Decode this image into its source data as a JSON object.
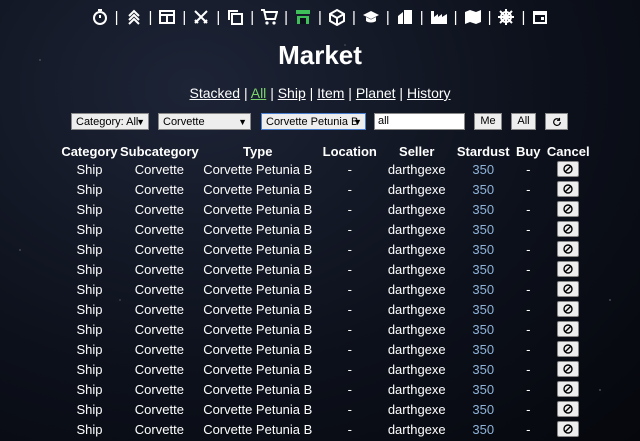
{
  "nav": {
    "icons": [
      "stopwatch-icon",
      "rank-chevrons-icon",
      "dashboard-icon",
      "crossed-swords-icon",
      "copy-icon",
      "cart-icon",
      "market-icon",
      "box-icon",
      "graduation-cap-icon",
      "city-icon",
      "factory-icon",
      "map-icon",
      "ship-wheel-icon",
      "calendar-icon"
    ],
    "active_icon": "market-icon",
    "active_color": "#3fbf5a"
  },
  "page_title": "Market",
  "filters": {
    "stacked": "Stacked",
    "all": "All",
    "ship": "Ship",
    "item": "Item",
    "planet": "Planet",
    "history": "History",
    "separator": "|"
  },
  "controls": {
    "category": "Category: All",
    "subcategory": "Corvette",
    "type": "Corvette Petunia B",
    "search_value": "all",
    "me_label": "Me",
    "all_label": "All"
  },
  "table": {
    "headers": [
      "Category",
      "Subcategory",
      "Type",
      "Location",
      "Seller",
      "Stardust",
      "Buy",
      "Cancel"
    ],
    "rows": [
      [
        "Ship",
        "Corvette",
        "Corvette Petunia B",
        "-",
        "darthgexe",
        "350",
        "-"
      ],
      [
        "Ship",
        "Corvette",
        "Corvette Petunia B",
        "-",
        "darthgexe",
        "350",
        "-"
      ],
      [
        "Ship",
        "Corvette",
        "Corvette Petunia B",
        "-",
        "darthgexe",
        "350",
        "-"
      ],
      [
        "Ship",
        "Corvette",
        "Corvette Petunia B",
        "-",
        "darthgexe",
        "350",
        "-"
      ],
      [
        "Ship",
        "Corvette",
        "Corvette Petunia B",
        "-",
        "darthgexe",
        "350",
        "-"
      ],
      [
        "Ship",
        "Corvette",
        "Corvette Petunia B",
        "-",
        "darthgexe",
        "350",
        "-"
      ],
      [
        "Ship",
        "Corvette",
        "Corvette Petunia B",
        "-",
        "darthgexe",
        "350",
        "-"
      ],
      [
        "Ship",
        "Corvette",
        "Corvette Petunia B",
        "-",
        "darthgexe",
        "350",
        "-"
      ],
      [
        "Ship",
        "Corvette",
        "Corvette Petunia B",
        "-",
        "darthgexe",
        "350",
        "-"
      ],
      [
        "Ship",
        "Corvette",
        "Corvette Petunia B",
        "-",
        "darthgexe",
        "350",
        "-"
      ],
      [
        "Ship",
        "Corvette",
        "Corvette Petunia B",
        "-",
        "darthgexe",
        "350",
        "-"
      ],
      [
        "Ship",
        "Corvette",
        "Corvette Petunia B",
        "-",
        "darthgexe",
        "350",
        "-"
      ],
      [
        "Ship",
        "Corvette",
        "Corvette Petunia B",
        "-",
        "darthgexe",
        "350",
        "-"
      ],
      [
        "Ship",
        "Corvette",
        "Corvette Petunia B",
        "-",
        "darthgexe",
        "350",
        "-"
      ]
    ]
  }
}
